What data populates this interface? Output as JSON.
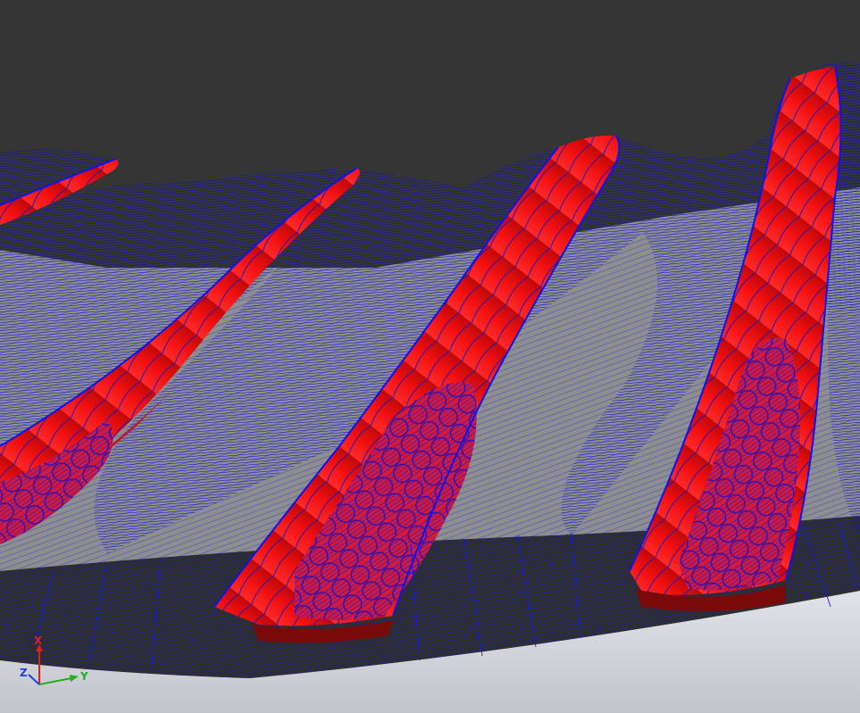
{
  "viewport": {
    "background_top": "#353535",
    "platform_color": "#8e8e8e",
    "rim_color": "#d6d6de",
    "toolpath_color": "#0a14f0",
    "stock_color": "#f01414",
    "stock_dark": "#8a0a0a"
  },
  "triad": {
    "x_label": "X",
    "y_label": "Y",
    "z_label": "Z",
    "x_color": "#e02020",
    "y_color": "#20b020",
    "z_color": "#2040e0"
  }
}
